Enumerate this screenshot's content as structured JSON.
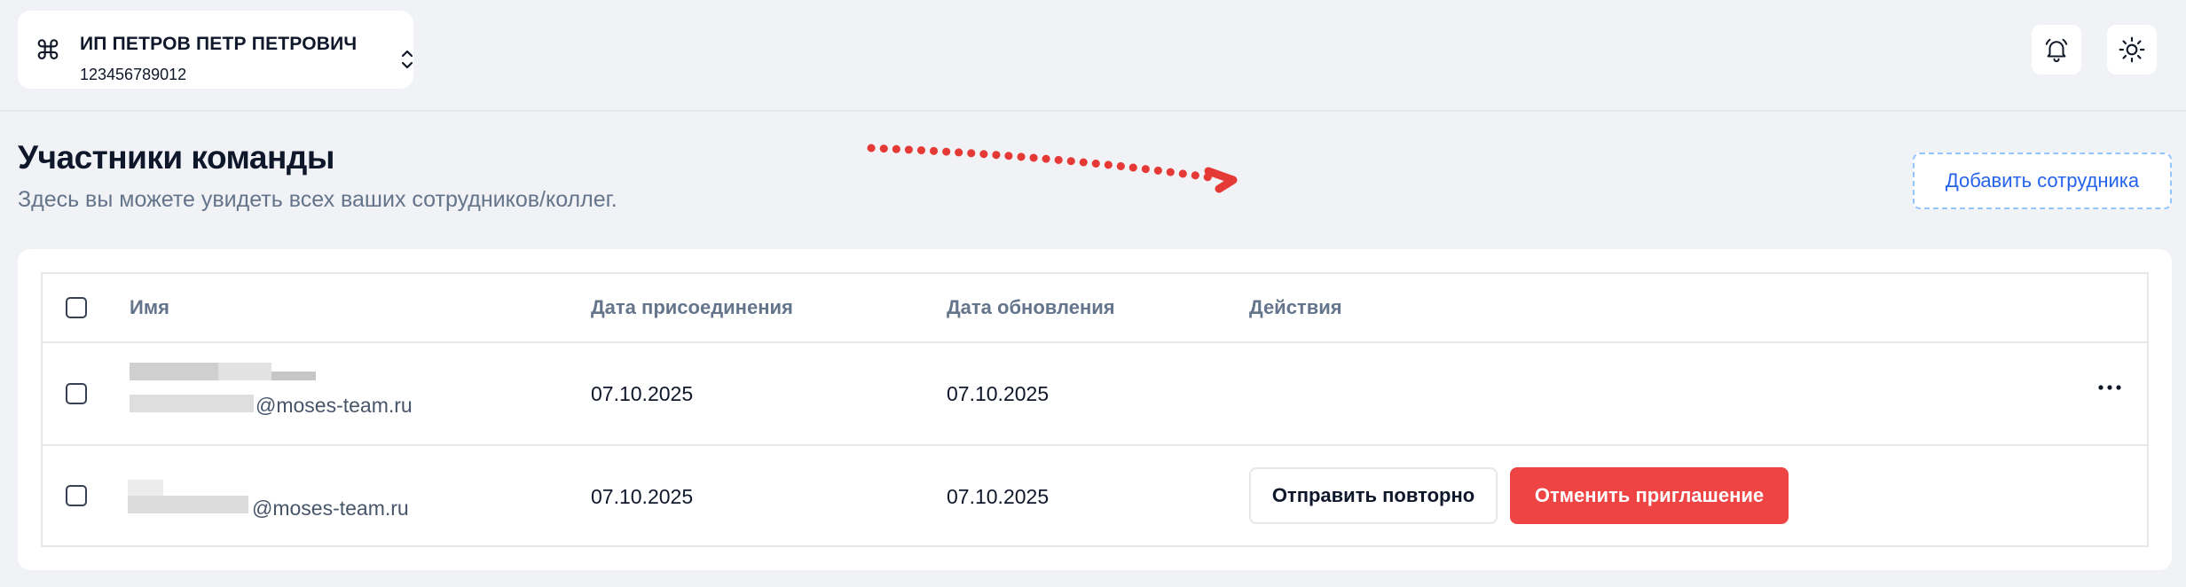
{
  "org": {
    "icon": "command-icon",
    "name": "ИП ПЕТРОВ ПЕТР ПЕТРОВИЧ",
    "inn": "123456789012"
  },
  "header_icons": [
    "bell-icon",
    "sun-icon"
  ],
  "page": {
    "title": "Участники команды",
    "subtitle": "Здесь вы можете увидеть всех ваших сотрудников/коллег.",
    "add_button": "Добавить сотрудника"
  },
  "table": {
    "columns": {
      "name": "Имя",
      "joined": "Дата присоединения",
      "updated": "Дата обновления",
      "actions": "Действия"
    },
    "rows": [
      {
        "email_domain": "@moses-team.ru",
        "joined": "07.10.2025",
        "updated": "07.10.2025",
        "more": "···"
      },
      {
        "email_domain": "@moses-team.ru",
        "joined": "07.10.2025",
        "updated": "07.10.2025",
        "resend": "Отправить повторно",
        "cancel": "Отменить приглашение"
      }
    ]
  },
  "colors": {
    "accent": "#2563eb",
    "danger": "#ef4444",
    "annotation": "#e53935",
    "background": "#f1f2f6"
  }
}
